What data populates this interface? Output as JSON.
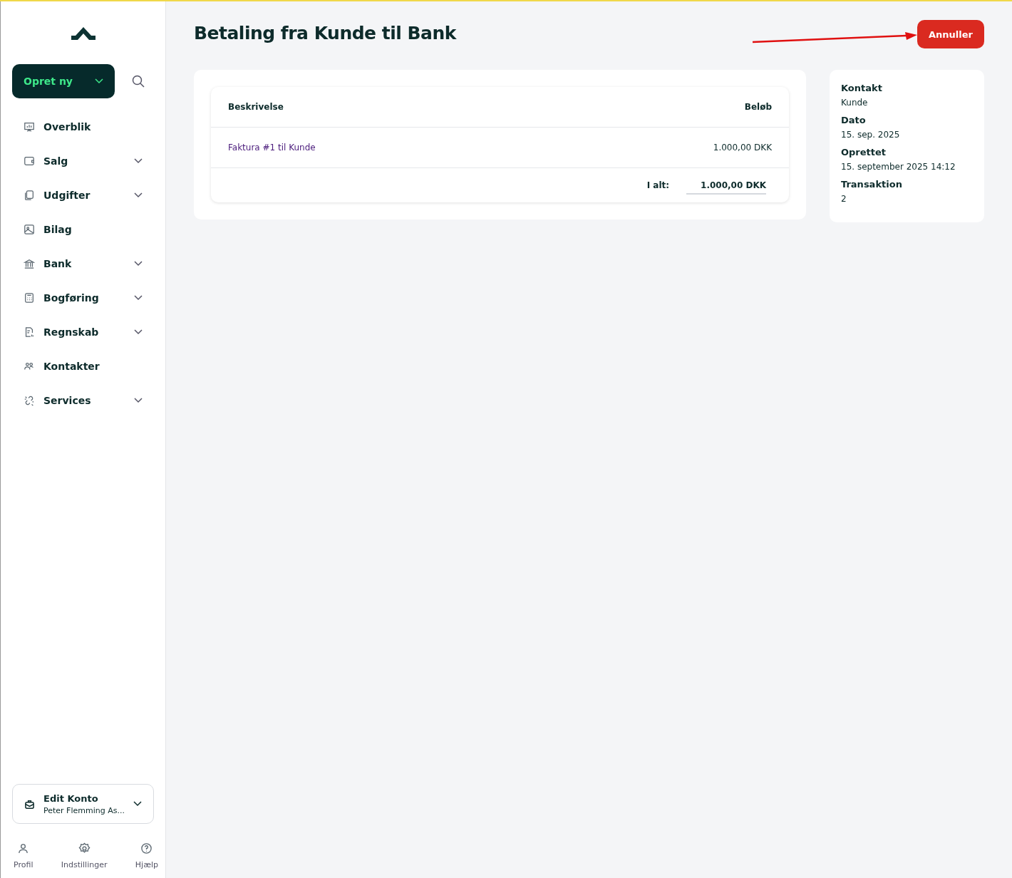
{
  "sidebar": {
    "create_button": {
      "label": "Opret ny"
    },
    "items": [
      {
        "label": "Overblik",
        "has_submenu": false
      },
      {
        "label": "Salg",
        "has_submenu": true
      },
      {
        "label": "Udgifter",
        "has_submenu": true
      },
      {
        "label": "Bilag",
        "has_submenu": false
      },
      {
        "label": "Bank",
        "has_submenu": true
      },
      {
        "label": "Bogføring",
        "has_submenu": true
      },
      {
        "label": "Regnskab",
        "has_submenu": true
      },
      {
        "label": "Kontakter",
        "has_submenu": false
      },
      {
        "label": "Services",
        "has_submenu": true
      }
    ],
    "account": {
      "title": "Edit Konto",
      "subtitle": "Peter Flemming As..."
    },
    "footer_links": [
      {
        "label": "Profil"
      },
      {
        "label": "Indstillinger"
      },
      {
        "label": "Hjælp"
      }
    ]
  },
  "page": {
    "title": "Betaling fra Kunde til Bank",
    "cancel_button": "Annuller"
  },
  "table": {
    "columns": [
      "Beskrivelse",
      "Beløb"
    ],
    "rows": [
      {
        "description": "Faktura #1 til Kunde",
        "amount": "1.000,00 DKK"
      }
    ],
    "total_label": "I alt:",
    "total": "1.000,00 DKK"
  },
  "details": [
    {
      "label": "Kontakt",
      "value": "Kunde"
    },
    {
      "label": "Dato",
      "value": "15. sep. 2025"
    },
    {
      "label": "Oprettet",
      "value": "15. september 2025 14:12"
    },
    {
      "label": "Transaktion",
      "value": "2"
    }
  ]
}
